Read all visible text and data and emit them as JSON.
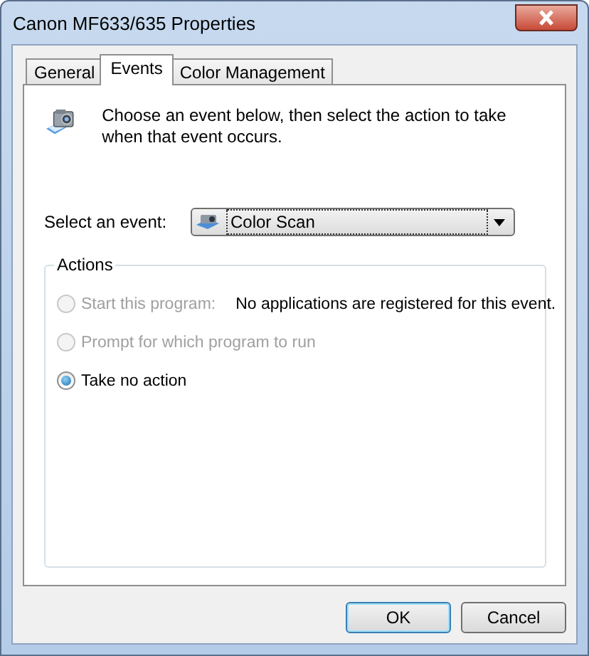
{
  "window": {
    "title": "Canon MF633/635 Properties"
  },
  "tabs": [
    {
      "label": "General",
      "selected": false
    },
    {
      "label": "Events",
      "selected": true
    },
    {
      "label": "Color Management",
      "selected": false
    }
  ],
  "description": "Choose an event below, then select the action to take when that event occurs.",
  "event_select": {
    "label": "Select an event:",
    "value": "Color Scan"
  },
  "actions": {
    "title": "Actions",
    "options": [
      {
        "label": "Start this program:",
        "selected": false,
        "disabled": true,
        "note": "No applications are registered for this event."
      },
      {
        "label": "Prompt for which program to run",
        "selected": false,
        "disabled": true
      },
      {
        "label": "Take no action",
        "selected": true,
        "disabled": false
      }
    ]
  },
  "buttons": [
    {
      "label": "OK",
      "default": true
    },
    {
      "label": "Cancel",
      "default": false
    }
  ]
}
